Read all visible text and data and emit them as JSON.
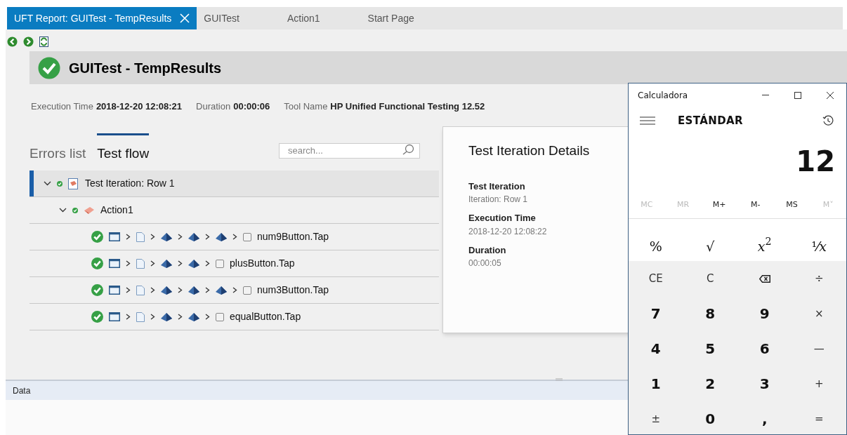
{
  "tabs": [
    {
      "label": "UFT Report: GUITest - TempResults",
      "selected": true,
      "closable": true
    },
    {
      "label": "GUITest",
      "selected": false,
      "closable": false
    },
    {
      "label": "Action1",
      "selected": false,
      "closable": false
    },
    {
      "label": "Start Page",
      "selected": false,
      "closable": false
    }
  ],
  "report": {
    "title": "GUITest - TempResults",
    "passed": true,
    "meta": [
      {
        "label": "Execution Time",
        "value": "2018-12-20 12:08:21"
      },
      {
        "label": "Duration",
        "value": "00:00:06"
      },
      {
        "label": "Tool Name",
        "value": "HP Unified Functional Testing 12.52"
      }
    ]
  },
  "views": [
    {
      "label": "Errors list",
      "selected": false
    },
    {
      "label": "Test flow",
      "selected": true
    }
  ],
  "search": {
    "placeholder": "search..."
  },
  "tree": [
    {
      "kind": "iteration",
      "label": "Test Iteration: Row 1",
      "passed": true,
      "expanded": true,
      "selected": true,
      "children": [
        {
          "kind": "action",
          "label": "Action1",
          "passed": true,
          "expanded": true,
          "selected": false,
          "children": [
            {
              "kind": "step",
              "label": "num9Button.Tap",
              "passed": true,
              "selected": false,
              "path": [
                {
                  "kind": "window"
                },
                {
                  "kind": "page"
                },
                {
                  "kind": "object"
                },
                {
                  "kind": "object"
                },
                {
                  "kind": "object"
                },
                {
                  "kind": "control"
                }
              ]
            },
            {
              "kind": "step",
              "label": "plusButton.Tap",
              "passed": true,
              "selected": false,
              "path": [
                {
                  "kind": "window"
                },
                {
                  "kind": "page"
                },
                {
                  "kind": "object"
                },
                {
                  "kind": "object"
                },
                {
                  "kind": "control"
                }
              ]
            },
            {
              "kind": "step",
              "label": "num3Button.Tap",
              "passed": true,
              "selected": false,
              "path": [
                {
                  "kind": "window"
                },
                {
                  "kind": "page"
                },
                {
                  "kind": "object"
                },
                {
                  "kind": "object"
                },
                {
                  "kind": "object"
                },
                {
                  "kind": "control"
                }
              ]
            },
            {
              "kind": "step",
              "label": "equalButton.Tap",
              "passed": true,
              "selected": false,
              "path": [
                {
                  "kind": "window"
                },
                {
                  "kind": "page"
                },
                {
                  "kind": "object"
                },
                {
                  "kind": "object"
                },
                {
                  "kind": "control"
                }
              ]
            }
          ]
        }
      ]
    }
  ],
  "details": {
    "title": "Test Iteration Details",
    "fields": [
      {
        "label": "Test Iteration",
        "value": "Iteration: Row 1"
      },
      {
        "label": "Execution Time",
        "value": "2018-12-20 12:08:22"
      },
      {
        "label": "Duration",
        "value": "00:00:05"
      }
    ]
  },
  "bottom_panel": {
    "title": "Data"
  },
  "calculator": {
    "title": "Calculadora",
    "mode": "ESTÁNDAR",
    "display": "12",
    "memory": [
      {
        "label": "MC",
        "disabled": true
      },
      {
        "label": "MR",
        "disabled": true
      },
      {
        "label": "M+",
        "disabled": false
      },
      {
        "label": "M-",
        "disabled": false
      },
      {
        "label": "MS",
        "disabled": false
      },
      {
        "label": "M˅",
        "disabled": true
      }
    ],
    "keys": [
      {
        "kind": "fn",
        "label": "%"
      },
      {
        "kind": "fn",
        "label": "√"
      },
      {
        "kind": "fn",
        "label": "*x*$^{2}$"
      },
      {
        "kind": "fn",
        "label": "¹⁄*x*"
      },
      {
        "kind": "op",
        "label": "CE"
      },
      {
        "kind": "op",
        "label": "C"
      },
      {
        "kind": "backspace"
      },
      {
        "kind": "op",
        "label": "÷"
      },
      {
        "kind": "digit",
        "label": "7"
      },
      {
        "kind": "digit",
        "label": "8"
      },
      {
        "kind": "digit",
        "label": "9"
      },
      {
        "kind": "op",
        "label": "×"
      },
      {
        "kind": "digit",
        "label": "4"
      },
      {
        "kind": "digit",
        "label": "5"
      },
      {
        "kind": "digit",
        "label": "6"
      },
      {
        "kind": "op",
        "label": "—"
      },
      {
        "kind": "digit",
        "label": "1"
      },
      {
        "kind": "digit",
        "label": "2"
      },
      {
        "kind": "digit",
        "label": "3"
      },
      {
        "kind": "op",
        "label": "+"
      },
      {
        "kind": "op",
        "label": "±"
      },
      {
        "kind": "digit",
        "label": "0"
      },
      {
        "kind": "digit",
        "label": ","
      },
      {
        "kind": "op",
        "label": "="
      }
    ]
  }
}
